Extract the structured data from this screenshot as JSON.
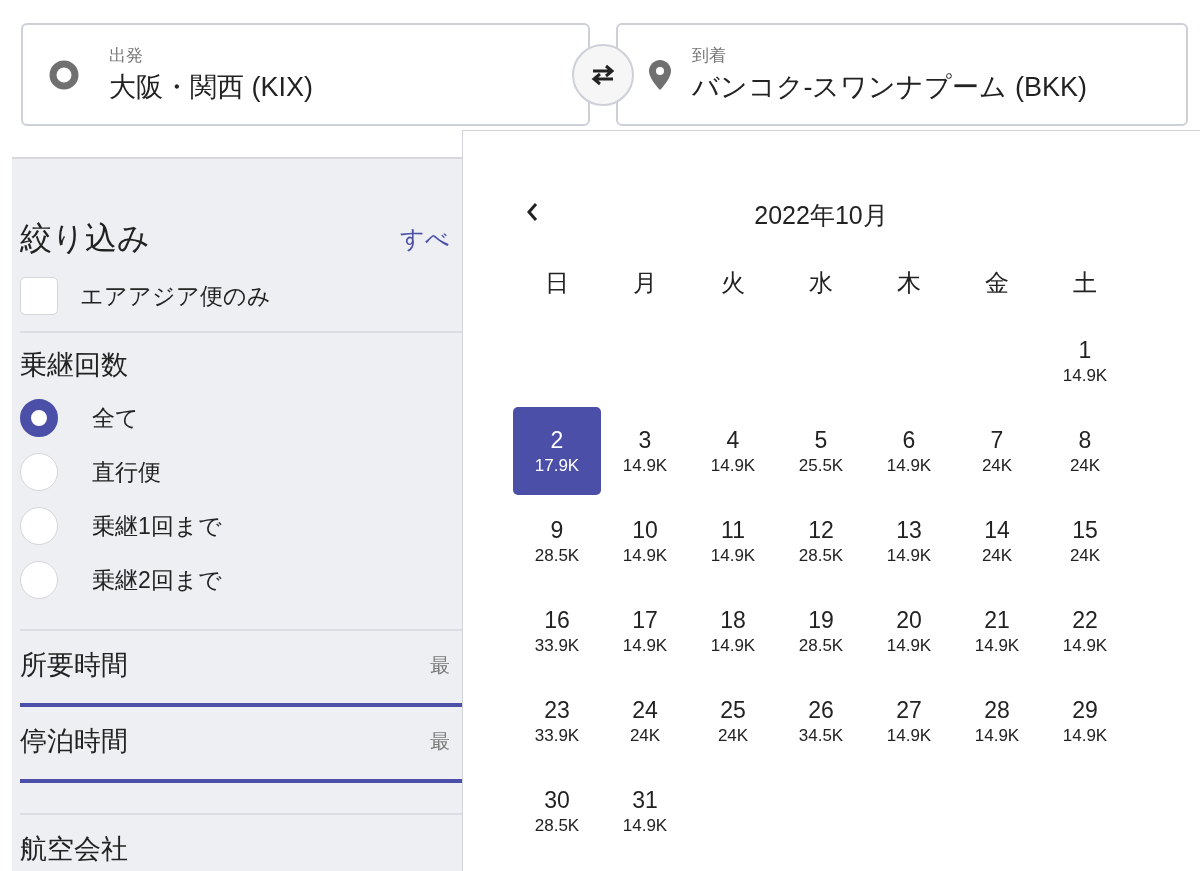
{
  "origin": {
    "label": "出発",
    "value": "大阪・関西 (KIX)"
  },
  "destination": {
    "label": "到着",
    "value": "バンコク-スワンナプーム (BKK)"
  },
  "filters": {
    "title": "絞り込み",
    "clear_link": "すべ",
    "airline_only": {
      "label": "エアアジア便のみ",
      "checked": false
    },
    "stops": {
      "title": "乗継回数",
      "options": [
        {
          "label": "全て",
          "selected": true
        },
        {
          "label": "直行便",
          "selected": false
        },
        {
          "label": "乗継1回まで",
          "selected": false
        },
        {
          "label": "乗継2回まで",
          "selected": false
        }
      ]
    },
    "ranges": [
      {
        "title": "所要時間",
        "column_2": "最",
        "level": 1
      },
      {
        "title": "停泊時間",
        "column_2": "最",
        "level": 1
      }
    ],
    "next_section": "航空会社"
  },
  "calendar": {
    "month": "2022年10月",
    "weekdays": [
      "日",
      "月",
      "火",
      "水",
      "木",
      "金",
      "土"
    ],
    "weeks": [
      [
        {
          "day": "1",
          "price": "14.9K",
          "selected": false
        }
      ],
      [
        {
          "day": "2",
          "price": "17.9K",
          "selected": true
        },
        {
          "day": "3",
          "price": "14.9K",
          "selected": false
        },
        {
          "day": "4",
          "price": "14.9K",
          "selected": false
        },
        {
          "day": "5",
          "price": "25.5K",
          "selected": false
        },
        {
          "day": "6",
          "price": "14.9K",
          "selected": false
        },
        {
          "day": "7",
          "price": "24K",
          "selected": false
        },
        {
          "day": "8",
          "price": "24K",
          "selected": false
        }
      ],
      [
        {
          "day": "9",
          "price": "28.5K",
          "selected": false
        },
        {
          "day": "10",
          "price": "14.9K",
          "selected": false
        },
        {
          "day": "11",
          "price": "14.9K",
          "selected": false
        },
        {
          "day": "12",
          "price": "28.5K",
          "selected": false
        },
        {
          "day": "13",
          "price": "14.9K",
          "selected": false
        },
        {
          "day": "14",
          "price": "24K",
          "selected": false
        },
        {
          "day": "15",
          "price": "24K",
          "selected": false
        }
      ],
      [
        {
          "day": "16",
          "price": "33.9K",
          "selected": false
        },
        {
          "day": "17",
          "price": "14.9K",
          "selected": false
        },
        {
          "day": "18",
          "price": "14.9K",
          "selected": false
        },
        {
          "day": "19",
          "price": "28.5K",
          "selected": false
        },
        {
          "day": "20",
          "price": "14.9K",
          "selected": false
        },
        {
          "day": "21",
          "price": "14.9K",
          "selected": false
        },
        {
          "day": "22",
          "price": "14.9K",
          "selected": false
        }
      ],
      [
        {
          "day": "23",
          "price": "33.9K",
          "selected": false
        },
        {
          "day": "24",
          "price": "24K",
          "selected": false
        },
        {
          "day": "25",
          "price": "24K",
          "selected": false
        },
        {
          "day": "26",
          "price": "34.5K",
          "selected": false
        },
        {
          "day": "27",
          "price": "14.9K",
          "selected": false
        },
        {
          "day": "28",
          "price": "14.9K",
          "selected": false
        },
        {
          "day": "29",
          "price": "14.9K",
          "selected": false
        }
      ],
      [
        {
          "day": "30",
          "price": "28.5K",
          "selected": false
        },
        {
          "day": "31",
          "price": "14.9K",
          "selected": false
        }
      ]
    ]
  }
}
